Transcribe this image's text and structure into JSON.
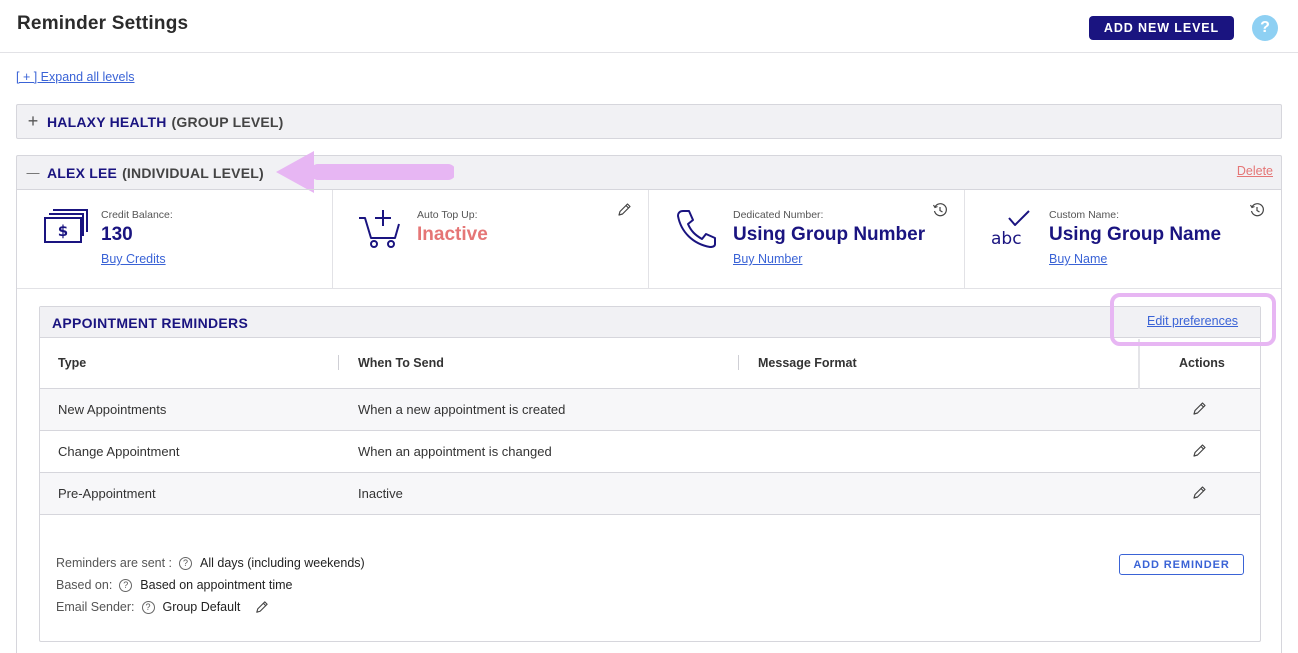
{
  "header": {
    "title": "Reminder Settings",
    "add_level_label": "ADD NEW LEVEL",
    "help_label": "?"
  },
  "expand_all_label": "[ + ] Expand all levels",
  "group_level": {
    "toggle": "+",
    "name": "HALAXY HEALTH",
    "type": "(GROUP LEVEL)"
  },
  "individual_level": {
    "toggle": "—",
    "name": "ALEX LEE",
    "type": "(INDIVIDUAL LEVEL)",
    "delete_label": "Delete",
    "stats": {
      "credit": {
        "label": "Credit Balance:",
        "value": "130",
        "link": "Buy Credits",
        "icon": "credits-icon"
      },
      "topup": {
        "label": "Auto Top Up:",
        "value": "Inactive",
        "icon": "cart-add-icon"
      },
      "number": {
        "label": "Dedicated Number:",
        "value": "Using Group Number",
        "link": "Buy Number",
        "icon": "phone-icon"
      },
      "name": {
        "label": "Custom Name:",
        "value": "Using Group Name",
        "link": "Buy Name",
        "icon": "abc-check-icon"
      }
    }
  },
  "appointment_reminders": {
    "title": "APPOINTMENT REMINDERS",
    "edit_preferences_label": "Edit preferences",
    "columns": [
      "Type",
      "When To Send",
      "Message Format",
      "Actions"
    ],
    "rows": [
      {
        "type": "New Appointments",
        "when": "When a new appointment is created",
        "format": ""
      },
      {
        "type": "Change Appointment",
        "when": "When an appointment is changed",
        "format": ""
      },
      {
        "type": "Pre-Appointment",
        "when": "Inactive",
        "format": ""
      }
    ],
    "info": {
      "sent_label": "Reminders are sent :",
      "sent_value": "All days (including weekends)",
      "based_label": "Based on:",
      "based_value": "Based on appointment time",
      "sender_label": "Email Sender:",
      "sender_value": "Group Default",
      "help_glyph": "?"
    },
    "add_reminder_label": "ADD REMINDER"
  },
  "colors": {
    "brand_navy": "#1a1480",
    "link_blue": "#3a63d6",
    "inactive_red": "#e57676",
    "annotation_pink": "#e7b6f3",
    "help_blue": "#8ed0f3"
  }
}
